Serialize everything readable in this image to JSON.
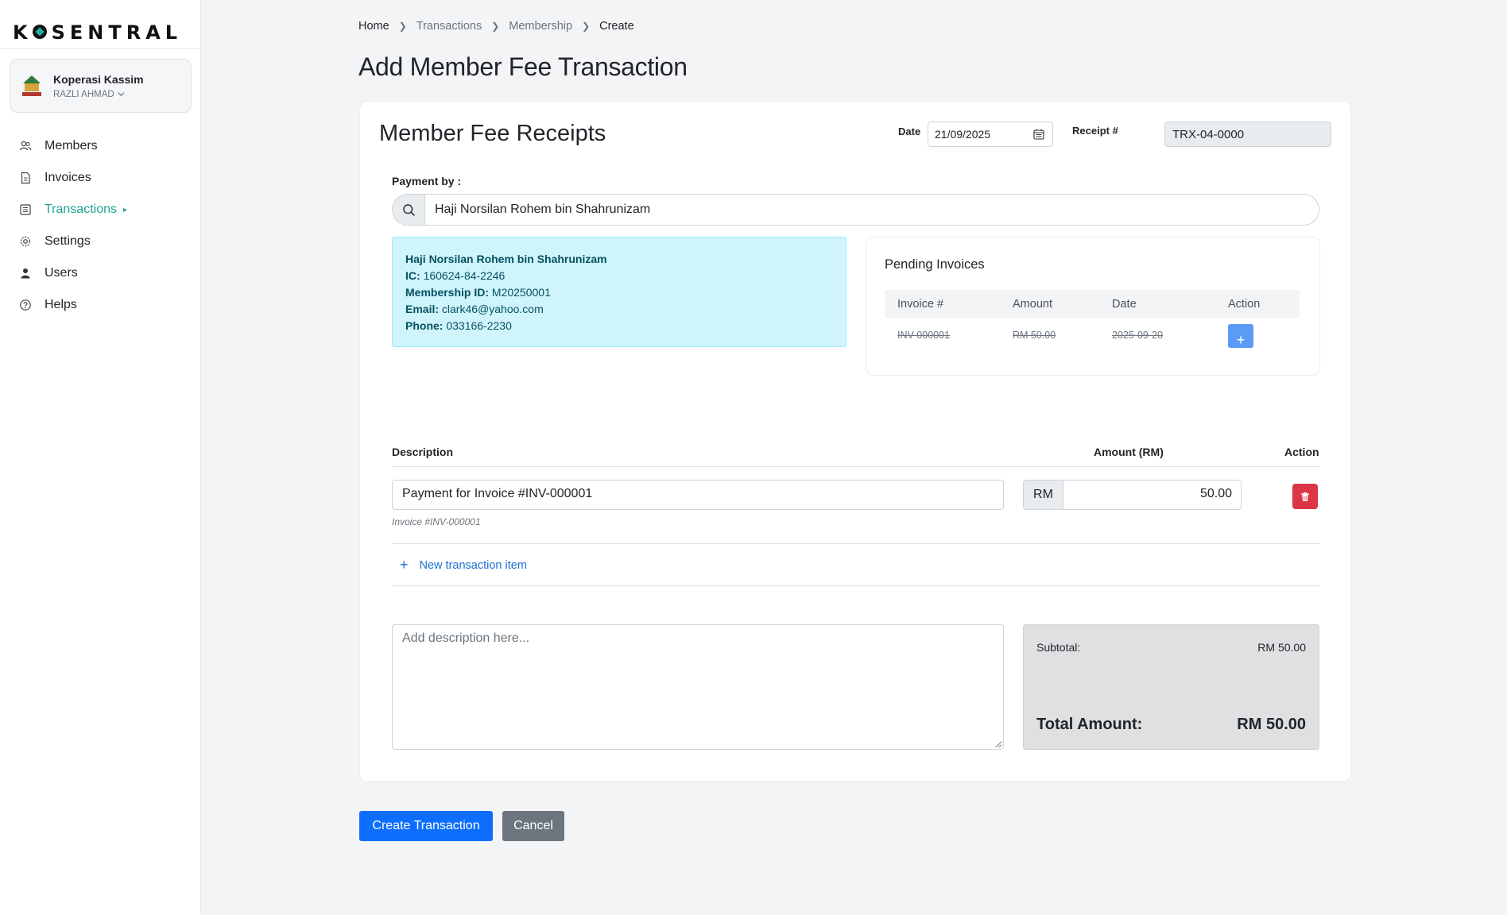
{
  "brand": {
    "logo_text_pre": "K",
    "logo_text_post": "SENTRAL"
  },
  "org": {
    "name": "Koperasi Kassim",
    "user": "RAZLI AHMAD"
  },
  "nav": {
    "items": [
      {
        "label": "Members",
        "icon": "members-icon"
      },
      {
        "label": "Invoices",
        "icon": "invoice-icon"
      },
      {
        "label": "Transactions",
        "icon": "transactions-icon",
        "active": true
      },
      {
        "label": "Settings",
        "icon": "gear-icon"
      },
      {
        "label": "Users",
        "icon": "user-icon"
      },
      {
        "label": "Helps",
        "icon": "help-icon"
      }
    ]
  },
  "breadcrumb": [
    "Home",
    "Transactions",
    "Membership",
    "Create"
  ],
  "page": {
    "title": "Add Member Fee Transaction"
  },
  "form": {
    "card_title": "Member Fee Receipts",
    "date_label": "Date",
    "date_value": "21/09/2025",
    "receipt_label": "Receipt #",
    "receipt_value": "TRX-04-0000",
    "payment_by_label": "Payment by :",
    "payment_by_value": "Haji Norsilan Rohem bin Shahrunizam"
  },
  "member": {
    "name": "Haji Norsilan Rohem bin Shahrunizam",
    "ic_label": "IC:",
    "ic": "160624-84-2246",
    "membership_label": "Membership ID:",
    "membership_id": "M20250001",
    "email_label": "Email:",
    "email": "clark46@yahoo.com",
    "phone_label": "Phone:",
    "phone": "033166-2230"
  },
  "pending": {
    "title": "Pending Invoices",
    "columns": [
      "Invoice #",
      "Amount",
      "Date",
      "Action"
    ],
    "rows": [
      {
        "invoice": "INV-000001",
        "amount": "RM 50.00",
        "date": "2025-09-20",
        "action": "+"
      }
    ]
  },
  "items": {
    "columns": {
      "description": "Description",
      "amount": "Amount (RM)",
      "action": "Action"
    },
    "rows": [
      {
        "description": "Payment for Invoice #INV-000001",
        "sub": "Invoice #INV-000001",
        "currency": "RM",
        "amount": "50.00"
      }
    ],
    "new_item_label": "New transaction item"
  },
  "notes": {
    "placeholder": "Add description here..."
  },
  "totals": {
    "subtotal_label": "Subtotal:",
    "subtotal": "RM 50.00",
    "total_label": "Total Amount:",
    "total": "RM 50.00"
  },
  "actions": {
    "create": "Create Transaction",
    "cancel": "Cancel"
  },
  "colors": {
    "accent": "#20a58f",
    "primary": "#0d6efd",
    "danger": "#dc3545",
    "info_bg": "#cff4fc"
  }
}
